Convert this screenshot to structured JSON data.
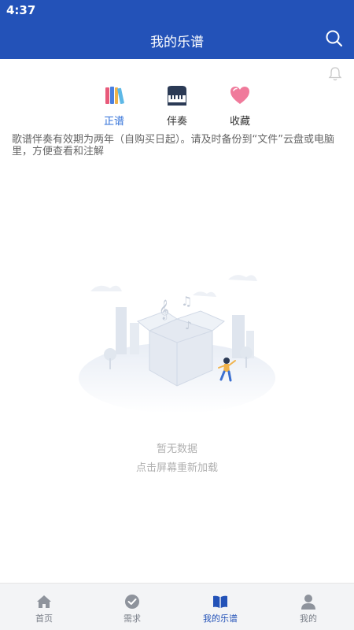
{
  "status_bar": {
    "time": "4:37"
  },
  "header": {
    "title": "我的乐谱",
    "search_icon": "search-icon"
  },
  "notification_icon": "bell-icon",
  "tabs": [
    {
      "label": "正谱",
      "icon": "books-icon",
      "active": true
    },
    {
      "label": "伴奏",
      "icon": "piano-icon",
      "active": false
    },
    {
      "label": "收藏",
      "icon": "heart-icon",
      "active": false
    }
  ],
  "notice": "歌谱伴奏有效期为两年（自购买日起）。请及时备份到“文件”云盘或电脑里，方便查看和注解",
  "empty_state": {
    "title": "暂无数据",
    "hint": "点击屏幕重新加载",
    "illustration": "empty-box-illustration"
  },
  "bottom_nav": [
    {
      "label": "首页",
      "icon": "home-icon"
    },
    {
      "label": "需求",
      "icon": "check-circle-icon"
    },
    {
      "label": "我的乐谱",
      "icon": "open-book-icon",
      "active": true
    },
    {
      "label": "我的",
      "icon": "user-icon"
    }
  ],
  "colors": {
    "primary": "#2352b8",
    "accent": "#2f6fd8",
    "muted": "#b0b0b0"
  }
}
